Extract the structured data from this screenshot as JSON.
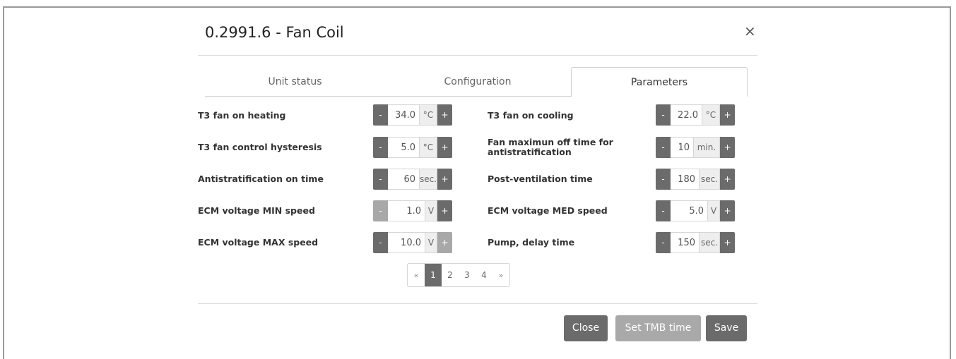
{
  "dialog": {
    "title": "0.2991.6 - Fan Coil",
    "close_icon": "×"
  },
  "tabs": [
    {
      "label": "Unit status",
      "active": false
    },
    {
      "label": "Configuration",
      "active": false
    },
    {
      "label": "Parameters",
      "active": true
    }
  ],
  "params_left": [
    {
      "label": "T3 fan on heating",
      "value": "34.0",
      "unit": "°C",
      "minus_disabled": false,
      "plus_disabled": false
    },
    {
      "label": "T3 fan control hysteresis",
      "value": "5.0",
      "unit": "°C",
      "minus_disabled": false,
      "plus_disabled": false
    },
    {
      "label": "Antistratification on time",
      "value": "60",
      "unit": "sec.",
      "minus_disabled": false,
      "plus_disabled": false
    },
    {
      "label": "ECM voltage MIN speed",
      "value": "1.0",
      "unit": "V",
      "minus_disabled": true,
      "plus_disabled": false
    },
    {
      "label": "ECM voltage MAX speed",
      "value": "10.0",
      "unit": "V",
      "minus_disabled": false,
      "plus_disabled": true
    }
  ],
  "params_right": [
    {
      "label": "T3 fan on cooling",
      "value": "22.0",
      "unit": "°C",
      "minus_disabled": false,
      "plus_disabled": false
    },
    {
      "label_line1": "Fan maximun off time for",
      "label_line2": "antistratification",
      "value": "10",
      "unit": "min.",
      "minus_disabled": false,
      "plus_disabled": false
    },
    {
      "label": "Post-ventilation time",
      "value": "180",
      "unit": "sec.",
      "minus_disabled": false,
      "plus_disabled": false
    },
    {
      "label": "ECM voltage MED speed",
      "value": "5.0",
      "unit": "V",
      "minus_disabled": false,
      "plus_disabled": false
    },
    {
      "label": "Pump, delay time",
      "value": "150",
      "unit": "sec.",
      "minus_disabled": false,
      "plus_disabled": false
    }
  ],
  "stepper": {
    "minus": "-",
    "plus": "+"
  },
  "pagination": {
    "prev": "«",
    "pages": [
      "1",
      "2",
      "3",
      "4"
    ],
    "active_page": "1",
    "next": "»"
  },
  "footer": {
    "close_label": "Close",
    "set_tmb_label": "Set TMB time",
    "save_label": "Save"
  },
  "colors": {
    "button_dark": "#6b6b6b",
    "button_disabled": "#a8a8a8"
  }
}
